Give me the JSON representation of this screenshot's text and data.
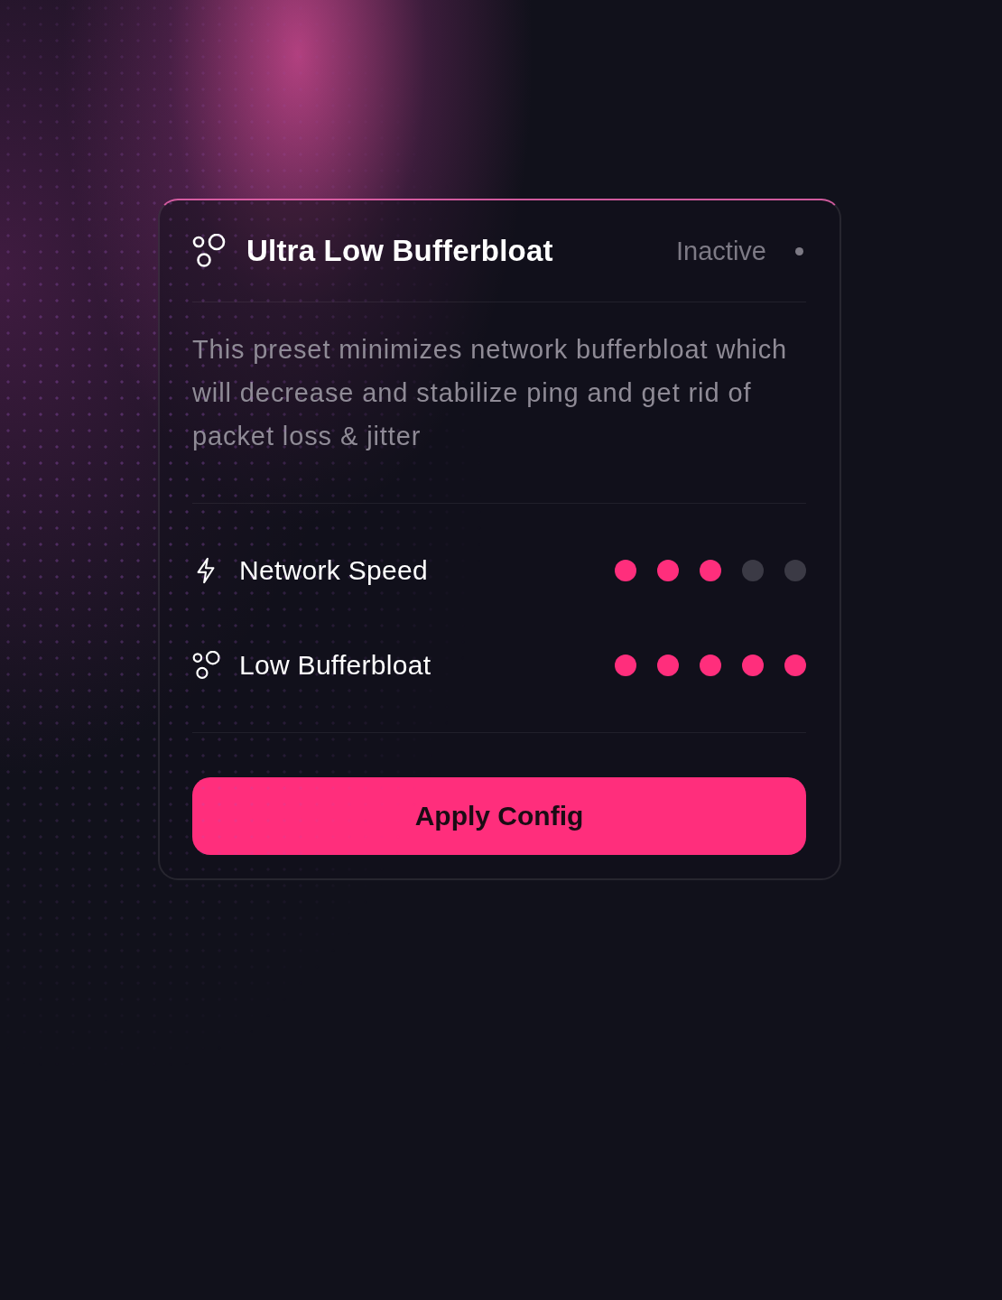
{
  "card": {
    "title": "Ultra Low Bufferbloat",
    "status": {
      "label": "Inactive",
      "active": false
    },
    "description": "This preset minimizes network bufferbloat which will decrease and stabilize ping and get rid of packet loss & jitter",
    "ratings": [
      {
        "kind": "bolt",
        "label": "Network Speed",
        "stars": 3
      },
      {
        "kind": "bubbles",
        "label": "Low Bufferbloat",
        "stars": 5
      }
    ],
    "button": "Apply Config"
  }
}
